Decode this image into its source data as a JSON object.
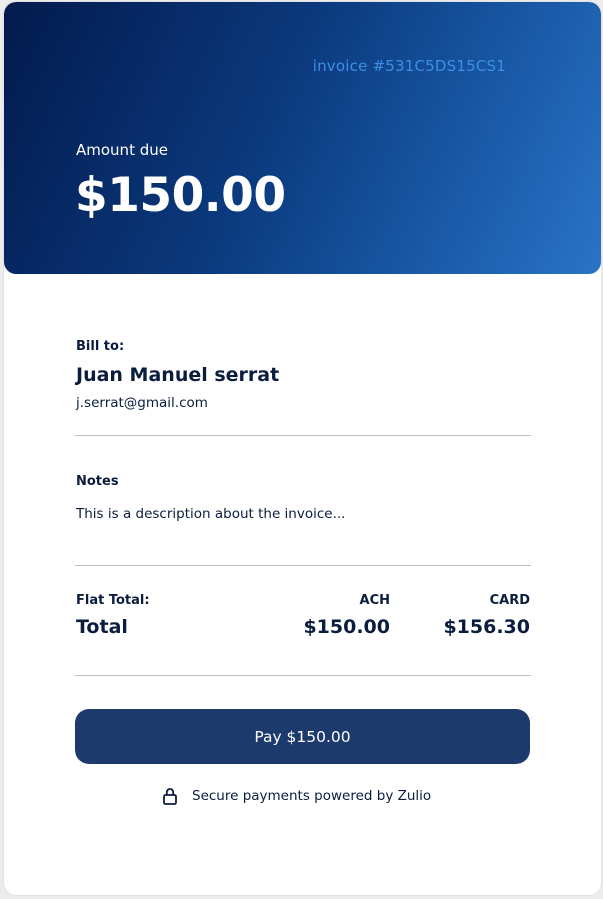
{
  "header": {
    "invoice_number": "invoice #531C5DS15CS1",
    "amount_label": "Amount due",
    "amount_value": "$150.00"
  },
  "bill_to": {
    "label": "Bill to:",
    "name": "Juan Manuel serrat",
    "email": "j.serrat@gmail.com"
  },
  "notes": {
    "label": "Notes",
    "text": "This is a description about the invoice..."
  },
  "totals": {
    "flat_label": "Flat Total:",
    "total_label": "Total",
    "ach_label": "ACH",
    "ach_value": "$150.00",
    "card_label": "CARD",
    "card_value": "$156.30"
  },
  "actions": {
    "pay_label": "Pay $150.00"
  },
  "footer": {
    "secure_text": "Secure payments powered by Zulio",
    "icon": "lock-icon"
  },
  "colors": {
    "hero_start": "#031a4d",
    "hero_end": "#2a74c6",
    "invoice_number": "#3d8fe6",
    "button": "#1c3a6c",
    "text": "#0b1d3f"
  }
}
